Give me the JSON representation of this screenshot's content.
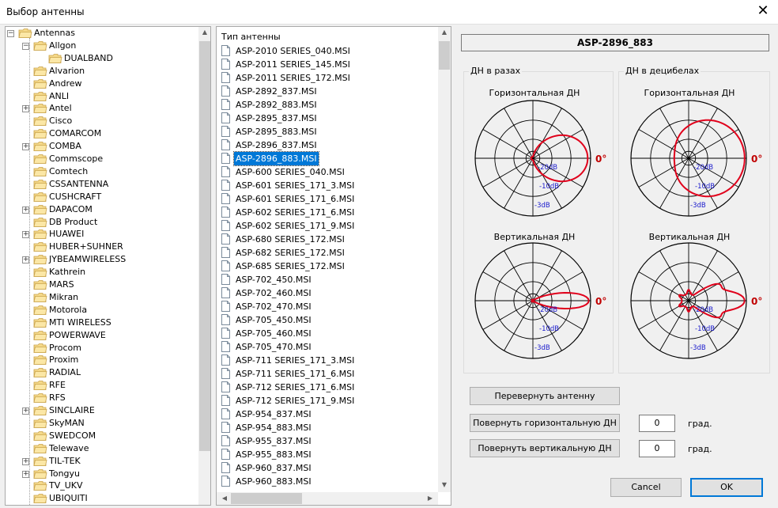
{
  "window": {
    "title": "Выбор антенны"
  },
  "tree": {
    "items": [
      {
        "label": "Antennas",
        "level": 0,
        "expander": "-"
      },
      {
        "label": "Allgon",
        "level": 1,
        "expander": "-"
      },
      {
        "label": "DUALBAND",
        "level": 2,
        "expander": ""
      },
      {
        "label": "Alvarion",
        "level": 1,
        "expander": ""
      },
      {
        "label": "Andrew",
        "level": 1,
        "expander": ""
      },
      {
        "label": "ANLI",
        "level": 1,
        "expander": ""
      },
      {
        "label": "Antel",
        "level": 1,
        "expander": "+"
      },
      {
        "label": "Cisco",
        "level": 1,
        "expander": ""
      },
      {
        "label": "COMARCOM",
        "level": 1,
        "expander": ""
      },
      {
        "label": "COMBA",
        "level": 1,
        "expander": "+"
      },
      {
        "label": "Commscope",
        "level": 1,
        "expander": ""
      },
      {
        "label": "Comtech",
        "level": 1,
        "expander": ""
      },
      {
        "label": "CSSANTENNA",
        "level": 1,
        "expander": ""
      },
      {
        "label": "CUSHCRAFT",
        "level": 1,
        "expander": ""
      },
      {
        "label": "DAPACOM",
        "level": 1,
        "expander": "+"
      },
      {
        "label": "DB Product",
        "level": 1,
        "expander": ""
      },
      {
        "label": "HUAWEI",
        "level": 1,
        "expander": "+"
      },
      {
        "label": "HUBER+SUHNER",
        "level": 1,
        "expander": ""
      },
      {
        "label": "JYBEAMWIRELESS",
        "level": 1,
        "expander": "+"
      },
      {
        "label": "Kathrein",
        "level": 1,
        "expander": ""
      },
      {
        "label": "MARS",
        "level": 1,
        "expander": ""
      },
      {
        "label": "Mikran",
        "level": 1,
        "expander": ""
      },
      {
        "label": "Motorola",
        "level": 1,
        "expander": ""
      },
      {
        "label": "MTI WIRELESS",
        "level": 1,
        "expander": ""
      },
      {
        "label": "POWERWAVE",
        "level": 1,
        "expander": ""
      },
      {
        "label": "Procom",
        "level": 1,
        "expander": ""
      },
      {
        "label": "Proxim",
        "level": 1,
        "expander": ""
      },
      {
        "label": "RADIAL",
        "level": 1,
        "expander": ""
      },
      {
        "label": "RFE",
        "level": 1,
        "expander": ""
      },
      {
        "label": "RFS",
        "level": 1,
        "expander": ""
      },
      {
        "label": "SINCLAIRE",
        "level": 1,
        "expander": "+"
      },
      {
        "label": "SkyMAN",
        "level": 1,
        "expander": ""
      },
      {
        "label": "SWEDCOM",
        "level": 1,
        "expander": ""
      },
      {
        "label": "Telewave",
        "level": 1,
        "expander": ""
      },
      {
        "label": "TIL-TEK",
        "level": 1,
        "expander": "+"
      },
      {
        "label": "Tongyu",
        "level": 1,
        "expander": "+"
      },
      {
        "label": "TV_UKV",
        "level": 1,
        "expander": ""
      },
      {
        "label": "UBIQUITI",
        "level": 1,
        "expander": ""
      }
    ]
  },
  "list": {
    "header": "Тип антенны",
    "selected_index": 8,
    "items": [
      "ASP-2010 SERIES_040.MSI",
      "ASP-2011 SERIES_145.MSI",
      "ASP-2011 SERIES_172.MSI",
      "ASP-2892_837.MSI",
      "ASP-2892_883.MSI",
      "ASP-2895_837.MSI",
      "ASP-2895_883.MSI",
      "ASP-2896_837.MSI",
      "ASP-2896_883.MSI",
      "ASP-600 SERIES_040.MSI",
      "ASP-601 SERIES_171_3.MSI",
      "ASP-601 SERIES_171_6.MSI",
      "ASP-602 SERIES_171_6.MSI",
      "ASP-602 SERIES_171_9.MSI",
      "ASP-680 SERIES_172.MSI",
      "ASP-682 SERIES_172.MSI",
      "ASP-685 SERIES_172.MSI",
      "ASP-702_450.MSI",
      "ASP-702_460.MSI",
      "ASP-702_470.MSI",
      "ASP-705_450.MSI",
      "ASP-705_460.MSI",
      "ASP-705_470.MSI",
      "ASP-711 SERIES_171_3.MSI",
      "ASP-711 SERIES_171_6.MSI",
      "ASP-712 SERIES_171_6.MSI",
      "ASP-712 SERIES_171_9.MSI",
      "ASP-954_837.MSI",
      "ASP-954_883.MSI",
      "ASP-955_837.MSI",
      "ASP-955_883.MSI",
      "ASP-960_837.MSI",
      "ASP-960_883.MSI"
    ],
    "scroll_position": 0.0
  },
  "panel": {
    "antenna_name": "ASP-2896_883",
    "group_linear": "ДН в разах",
    "group_db": "ДН в децибелах",
    "horizontal_title": "Горизонтальная ДН",
    "vertical_title": "Вертикальная ДН",
    "zero_label": "0°",
    "db_labels": [
      "-20dB",
      "-10dB",
      "-3dB"
    ],
    "btn_flip": "Перевернуть антенну",
    "btn_rotate_h": "Повернуть горизонтальную ДН",
    "btn_rotate_v": "Повернуть вертикальную ДН",
    "rotate_h_value": "0",
    "rotate_v_value": "0",
    "unit": "град.",
    "btn_cancel": "Cancel",
    "btn_ok": "OK"
  },
  "colors": {
    "pattern": "#e0001b",
    "db_text": "#1a1acc",
    "selection": "#0078d7",
    "zero_text": "#c00000"
  }
}
